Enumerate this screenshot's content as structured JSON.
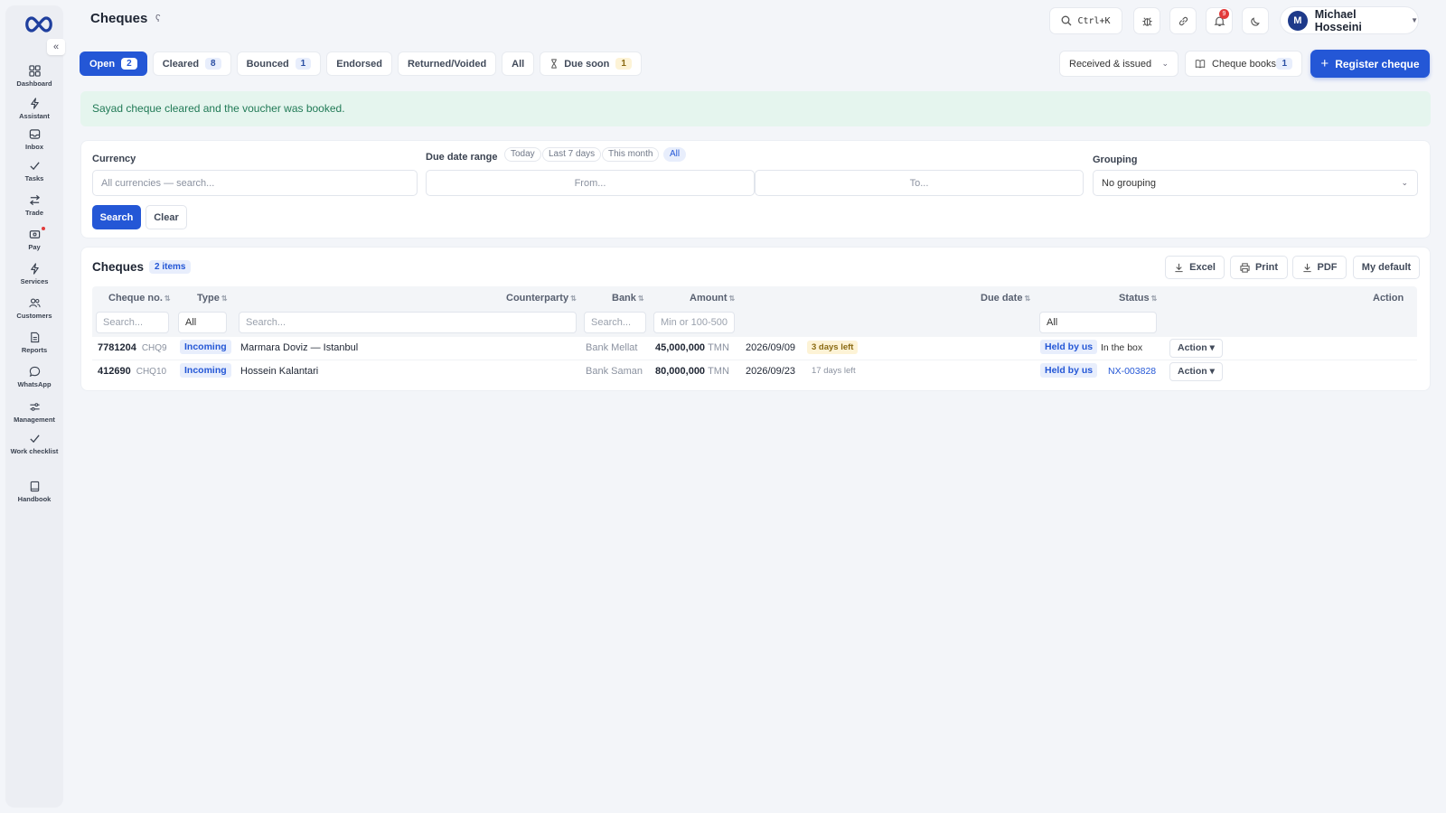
{
  "sidebar": {
    "collapse_icon": "«",
    "items": [
      {
        "label": "Dashboard",
        "icon": "grid-icon"
      },
      {
        "label": "Assistant",
        "icon": "bolt-icon"
      },
      {
        "label": "Inbox",
        "icon": "inbox-icon"
      },
      {
        "label": "Tasks",
        "icon": "check-icon"
      },
      {
        "label": "Trade",
        "icon": "swap-icon"
      },
      {
        "label": "Pay",
        "icon": "wallet-icon"
      },
      {
        "label": "Services",
        "icon": "bolt-icon"
      },
      {
        "label": "Customers",
        "icon": "users-icon"
      },
      {
        "label": "Reports",
        "icon": "report-icon"
      },
      {
        "label": "WhatsApp",
        "icon": "chat-icon"
      },
      {
        "label": "Management",
        "icon": "sliders-icon"
      },
      {
        "label": "Work checklist",
        "icon": "check-icon"
      },
      {
        "label": "Handbook",
        "icon": "book-icon"
      }
    ]
  },
  "header": {
    "title": "Cheques",
    "title_icon": "ʕ",
    "search_shortcut": "Ctrl+K",
    "notification_count": "9",
    "user": {
      "initial": "M",
      "name": "Michael Hosseini"
    }
  },
  "tabs": [
    {
      "label": "Open",
      "count": "2"
    },
    {
      "label": "Cleared",
      "count": "8"
    },
    {
      "label": "Bounced",
      "count": "1"
    },
    {
      "label": "Endorsed",
      "count": ""
    },
    {
      "label": "Returned/Voided",
      "count": ""
    },
    {
      "label": "All",
      "count": ""
    },
    {
      "label": "Due soon",
      "count": "1"
    }
  ],
  "toolbar": {
    "direction_select": "Received & issued",
    "cheque_books_label": "Cheque books",
    "cheque_books_count": "1",
    "register_label": "Register cheque"
  },
  "alert": {
    "message": "Sayad cheque cleared and the voucher was booked."
  },
  "filters": {
    "currency_label": "Currency",
    "currency_placeholder": "All currencies — search...",
    "due_label": "Due date range",
    "due_chips": [
      "Today",
      "Last 7 days",
      "This month",
      "All"
    ],
    "from_placeholder": "From...",
    "to_placeholder": "To...",
    "grouping_label": "Grouping",
    "grouping_value": "No grouping",
    "search_label": "Search",
    "clear_label": "Clear"
  },
  "table": {
    "title": "Cheques",
    "count_label": "2 items",
    "export": {
      "excel": "Excel",
      "print": "Print",
      "pdf": "PDF",
      "default": "My default"
    },
    "columns": [
      "Cheque no.",
      "Type",
      "Counterparty",
      "Bank",
      "Amount",
      "Due date",
      "Status",
      "Action"
    ],
    "column_filters": {
      "cheque_no": "Search...",
      "type": "All",
      "counterparty": "Search...",
      "bank": "Search...",
      "amount": "Min or 100-500",
      "status": "All"
    },
    "rows": [
      {
        "no": "7781204",
        "code": "CHQ9",
        "type": "Incoming",
        "counterparty": "Marmara Doviz — Istanbul",
        "bank": "Bank Mellat",
        "amount": "45,000,000",
        "currency": "TMN",
        "due": "2026/09/09",
        "days": "3 days left",
        "status": "Held by us",
        "location": "In the box",
        "action": "Action ▾"
      },
      {
        "no": "412690",
        "code": "CHQ10",
        "type": "Incoming",
        "counterparty": "Hossein Kalantari",
        "bank": "Bank Saman",
        "amount": "80,000,000",
        "currency": "TMN",
        "due": "2026/09/23",
        "days": "17 days left",
        "status": "Held by us",
        "location": "NX-003828",
        "action": "Action ▾"
      }
    ]
  },
  "colors": {
    "accent": "#2457d6",
    "success_bg": "#e5f5ee",
    "warn_bg": "#fdf3d6"
  }
}
